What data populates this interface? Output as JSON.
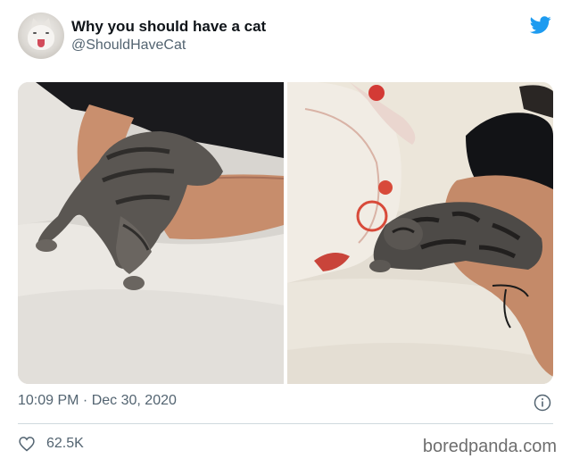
{
  "tweet": {
    "author_name": "Why you should have a cat",
    "author_handle": "@ShouldHaveCat",
    "timestamp": "10:09 PM · Dec 30, 2020",
    "like_count": "62.5K"
  },
  "icons": {
    "brand": "twitter-bird-icon",
    "info": "info-icon",
    "like": "heart-icon"
  },
  "colors": {
    "twitter_blue": "#1d9bf0",
    "secondary_text": "#536471",
    "divider": "#cfd9de"
  },
  "watermark": "boredpanda.com"
}
